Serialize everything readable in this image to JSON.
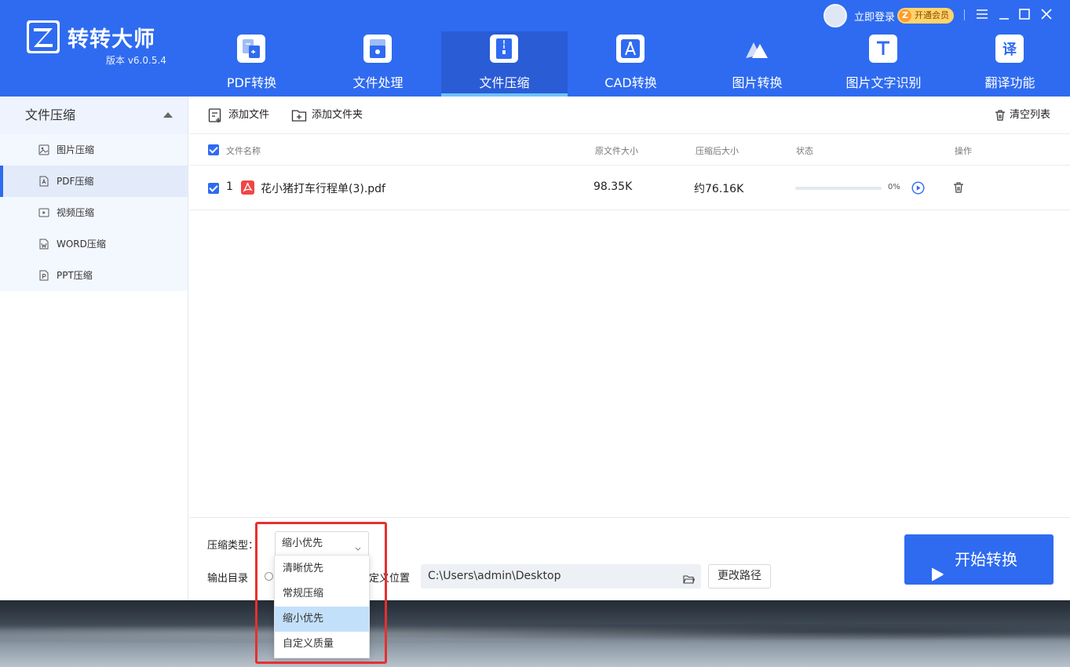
{
  "app": {
    "name": "转转大师",
    "version": "版本 v6.0.5.4",
    "login": "立即登录",
    "vip": "开通会员"
  },
  "nav_tabs": [
    {
      "label": "PDF转换",
      "icon": "pdf-convert-icon"
    },
    {
      "label": "文件处理",
      "icon": "file-process-icon"
    },
    {
      "label": "文件压缩",
      "icon": "zip-icon",
      "active": true
    },
    {
      "label": "CAD转换",
      "icon": "cad-icon"
    },
    {
      "label": "图片转换",
      "icon": "image-convert-icon"
    },
    {
      "label": "图片文字识别",
      "icon": "ocr-icon"
    },
    {
      "label": "翻译功能",
      "icon": "translate-icon"
    }
  ],
  "sidebar": {
    "title": "文件压缩",
    "items": [
      {
        "label": "图片压缩",
        "icon": "image-icon"
      },
      {
        "label": "PDF压缩",
        "icon": "pdf-icon",
        "active": true
      },
      {
        "label": "视频压缩",
        "icon": "video-icon"
      },
      {
        "label": "WORD压缩",
        "icon": "word-icon"
      },
      {
        "label": "PPT压缩",
        "icon": "ppt-icon"
      }
    ]
  },
  "toolbar": {
    "add_file": "添加文件",
    "add_folder": "添加文件夹",
    "clear_list": "清空列表"
  },
  "table": {
    "headers": {
      "name": "文件名称",
      "original_size": "原文件大小",
      "compressed_size": "压缩后大小",
      "status": "状态",
      "actions": "操作"
    },
    "rows": [
      {
        "index": "1",
        "name": "花小猪打车行程单(3).pdf",
        "original_size": "98.35K",
        "compressed_size": "约76.16K",
        "progress_text": "0%",
        "progress": 0
      }
    ]
  },
  "bottom": {
    "compress_type_label": "压缩类型：",
    "compress_type_value": "缩小优先",
    "output_label": "输出目录",
    "custom_location_label": "自定义位置",
    "path": "C:\\Users\\admin\\Desktop",
    "change_path": "更改路径",
    "start": "开始转换"
  },
  "dropdown": {
    "options": [
      "清晰优先",
      "常规压缩",
      "缩小优先",
      "自定义质量"
    ],
    "selected": "缩小优先"
  },
  "colors": {
    "brand": "#2f6bf0",
    "highlight": "#e63030"
  }
}
